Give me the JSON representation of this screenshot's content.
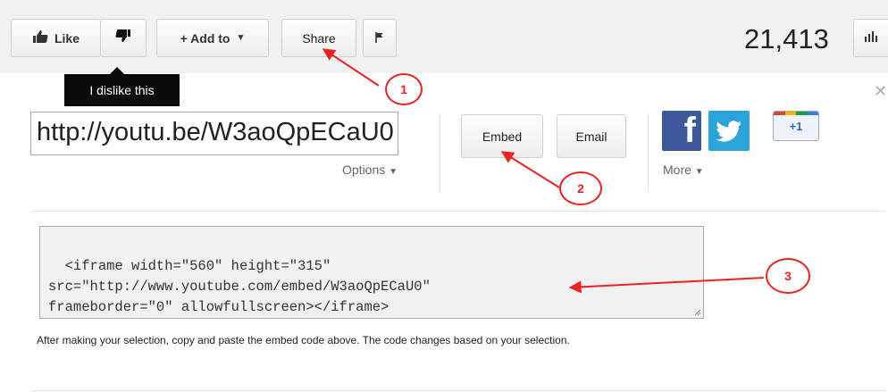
{
  "toolbar": {
    "like_label": "Like",
    "add_to_label": "+ Add to",
    "share_label": "Share",
    "view_count": "21,413"
  },
  "tooltip": {
    "text": "I dislike this"
  },
  "share_panel": {
    "short_url": "http://youtu.be/W3aoQpECaU0",
    "options_label": "Options",
    "embed_label": "Embed",
    "email_label": "Email",
    "more_label": "More",
    "facebook_glyph": "f",
    "gplus_label": "+1"
  },
  "embed": {
    "code": "<iframe width=\"560\" height=\"315\"\nsrc=\"http://www.youtube.com/embed/W3aoQpECaU0\"\nframeborder=\"0\" allowfullscreen></iframe>",
    "note": "After making your selection, copy and paste the embed code above. The code changes based on your selection."
  },
  "annotations": {
    "step1": "1",
    "step2": "2",
    "step3": "3"
  },
  "colors": {
    "annotation": "#ee2222",
    "facebook": "#3b5998",
    "twitter": "#2ba3d8"
  }
}
